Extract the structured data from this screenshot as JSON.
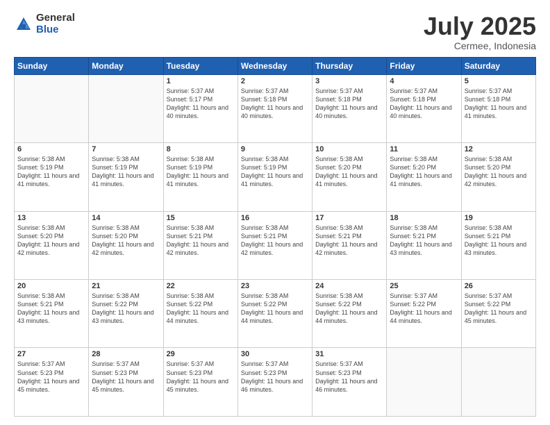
{
  "logo": {
    "general": "General",
    "blue": "Blue"
  },
  "title": "July 2025",
  "subtitle": "Cermee, Indonesia",
  "days_of_week": [
    "Sunday",
    "Monday",
    "Tuesday",
    "Wednesday",
    "Thursday",
    "Friday",
    "Saturday"
  ],
  "weeks": [
    [
      {
        "day": "",
        "empty": true
      },
      {
        "day": "",
        "empty": true
      },
      {
        "day": "1",
        "sunrise": "5:37 AM",
        "sunset": "5:17 PM",
        "daylight": "11 hours and 40 minutes."
      },
      {
        "day": "2",
        "sunrise": "5:37 AM",
        "sunset": "5:18 PM",
        "daylight": "11 hours and 40 minutes."
      },
      {
        "day": "3",
        "sunrise": "5:37 AM",
        "sunset": "5:18 PM",
        "daylight": "11 hours and 40 minutes."
      },
      {
        "day": "4",
        "sunrise": "5:37 AM",
        "sunset": "5:18 PM",
        "daylight": "11 hours and 40 minutes."
      },
      {
        "day": "5",
        "sunrise": "5:37 AM",
        "sunset": "5:18 PM",
        "daylight": "11 hours and 41 minutes."
      }
    ],
    [
      {
        "day": "6",
        "sunrise": "5:38 AM",
        "sunset": "5:19 PM",
        "daylight": "11 hours and 41 minutes."
      },
      {
        "day": "7",
        "sunrise": "5:38 AM",
        "sunset": "5:19 PM",
        "daylight": "11 hours and 41 minutes."
      },
      {
        "day": "8",
        "sunrise": "5:38 AM",
        "sunset": "5:19 PM",
        "daylight": "11 hours and 41 minutes."
      },
      {
        "day": "9",
        "sunrise": "5:38 AM",
        "sunset": "5:19 PM",
        "daylight": "11 hours and 41 minutes."
      },
      {
        "day": "10",
        "sunrise": "5:38 AM",
        "sunset": "5:20 PM",
        "daylight": "11 hours and 41 minutes."
      },
      {
        "day": "11",
        "sunrise": "5:38 AM",
        "sunset": "5:20 PM",
        "daylight": "11 hours and 41 minutes."
      },
      {
        "day": "12",
        "sunrise": "5:38 AM",
        "sunset": "5:20 PM",
        "daylight": "11 hours and 42 minutes."
      }
    ],
    [
      {
        "day": "13",
        "sunrise": "5:38 AM",
        "sunset": "5:20 PM",
        "daylight": "11 hours and 42 minutes."
      },
      {
        "day": "14",
        "sunrise": "5:38 AM",
        "sunset": "5:20 PM",
        "daylight": "11 hours and 42 minutes."
      },
      {
        "day": "15",
        "sunrise": "5:38 AM",
        "sunset": "5:21 PM",
        "daylight": "11 hours and 42 minutes."
      },
      {
        "day": "16",
        "sunrise": "5:38 AM",
        "sunset": "5:21 PM",
        "daylight": "11 hours and 42 minutes."
      },
      {
        "day": "17",
        "sunrise": "5:38 AM",
        "sunset": "5:21 PM",
        "daylight": "11 hours and 42 minutes."
      },
      {
        "day": "18",
        "sunrise": "5:38 AM",
        "sunset": "5:21 PM",
        "daylight": "11 hours and 43 minutes."
      },
      {
        "day": "19",
        "sunrise": "5:38 AM",
        "sunset": "5:21 PM",
        "daylight": "11 hours and 43 minutes."
      }
    ],
    [
      {
        "day": "20",
        "sunrise": "5:38 AM",
        "sunset": "5:21 PM",
        "daylight": "11 hours and 43 minutes."
      },
      {
        "day": "21",
        "sunrise": "5:38 AM",
        "sunset": "5:22 PM",
        "daylight": "11 hours and 43 minutes."
      },
      {
        "day": "22",
        "sunrise": "5:38 AM",
        "sunset": "5:22 PM",
        "daylight": "11 hours and 44 minutes."
      },
      {
        "day": "23",
        "sunrise": "5:38 AM",
        "sunset": "5:22 PM",
        "daylight": "11 hours and 44 minutes."
      },
      {
        "day": "24",
        "sunrise": "5:38 AM",
        "sunset": "5:22 PM",
        "daylight": "11 hours and 44 minutes."
      },
      {
        "day": "25",
        "sunrise": "5:37 AM",
        "sunset": "5:22 PM",
        "daylight": "11 hours and 44 minutes."
      },
      {
        "day": "26",
        "sunrise": "5:37 AM",
        "sunset": "5:22 PM",
        "daylight": "11 hours and 45 minutes."
      }
    ],
    [
      {
        "day": "27",
        "sunrise": "5:37 AM",
        "sunset": "5:23 PM",
        "daylight": "11 hours and 45 minutes."
      },
      {
        "day": "28",
        "sunrise": "5:37 AM",
        "sunset": "5:23 PM",
        "daylight": "11 hours and 45 minutes."
      },
      {
        "day": "29",
        "sunrise": "5:37 AM",
        "sunset": "5:23 PM",
        "daylight": "11 hours and 45 minutes."
      },
      {
        "day": "30",
        "sunrise": "5:37 AM",
        "sunset": "5:23 PM",
        "daylight": "11 hours and 46 minutes."
      },
      {
        "day": "31",
        "sunrise": "5:37 AM",
        "sunset": "5:23 PM",
        "daylight": "11 hours and 46 minutes."
      },
      {
        "day": "",
        "empty": true
      },
      {
        "day": "",
        "empty": true
      }
    ]
  ]
}
